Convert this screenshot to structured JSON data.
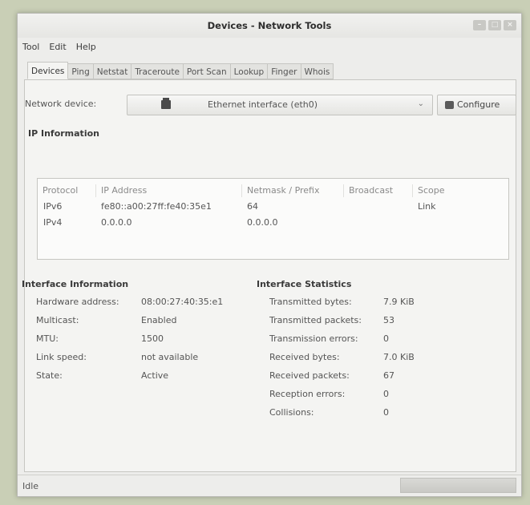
{
  "window": {
    "title": "Devices - Network Tools"
  },
  "menu": [
    "Tool",
    "Edit",
    "Help"
  ],
  "tabs": [
    "Devices",
    "Ping",
    "Netstat",
    "Traceroute",
    "Port Scan",
    "Lookup",
    "Finger",
    "Whois"
  ],
  "device": {
    "label": "Network device:",
    "value": "Ethernet interface (eth0)",
    "configure_label": "Configure"
  },
  "ip_info": {
    "title": "IP Information",
    "columns": [
      "Protocol",
      "IP Address",
      "Netmask / Prefix",
      "Broadcast",
      "Scope"
    ],
    "rows": [
      [
        "IPv6",
        "fe80::a00:27ff:fe40:35e1",
        "64",
        "",
        "Link"
      ],
      [
        "IPv4",
        "0.0.0.0",
        "0.0.0.0",
        "",
        ""
      ]
    ]
  },
  "interface_info": {
    "title": "Interface Information",
    "rows": [
      {
        "label": "Hardware address:",
        "value": "08:00:27:40:35:e1"
      },
      {
        "label": "Multicast:",
        "value": "Enabled"
      },
      {
        "label": "MTU:",
        "value": "1500"
      },
      {
        "label": "Link speed:",
        "value": "not available"
      },
      {
        "label": "State:",
        "value": "Active"
      }
    ]
  },
  "interface_stats": {
    "title": "Interface Statistics",
    "rows": [
      {
        "label": "Transmitted bytes:",
        "value": "7.9 KiB"
      },
      {
        "label": "Transmitted packets:",
        "value": "53"
      },
      {
        "label": "Transmission errors:",
        "value": "0"
      },
      {
        "label": "Received bytes:",
        "value": "7.0 KiB"
      },
      {
        "label": "Received packets:",
        "value": "67"
      },
      {
        "label": "Reception errors:",
        "value": "0"
      },
      {
        "label": "Collisions:",
        "value": "0"
      }
    ]
  },
  "status": {
    "text": "Idle"
  }
}
